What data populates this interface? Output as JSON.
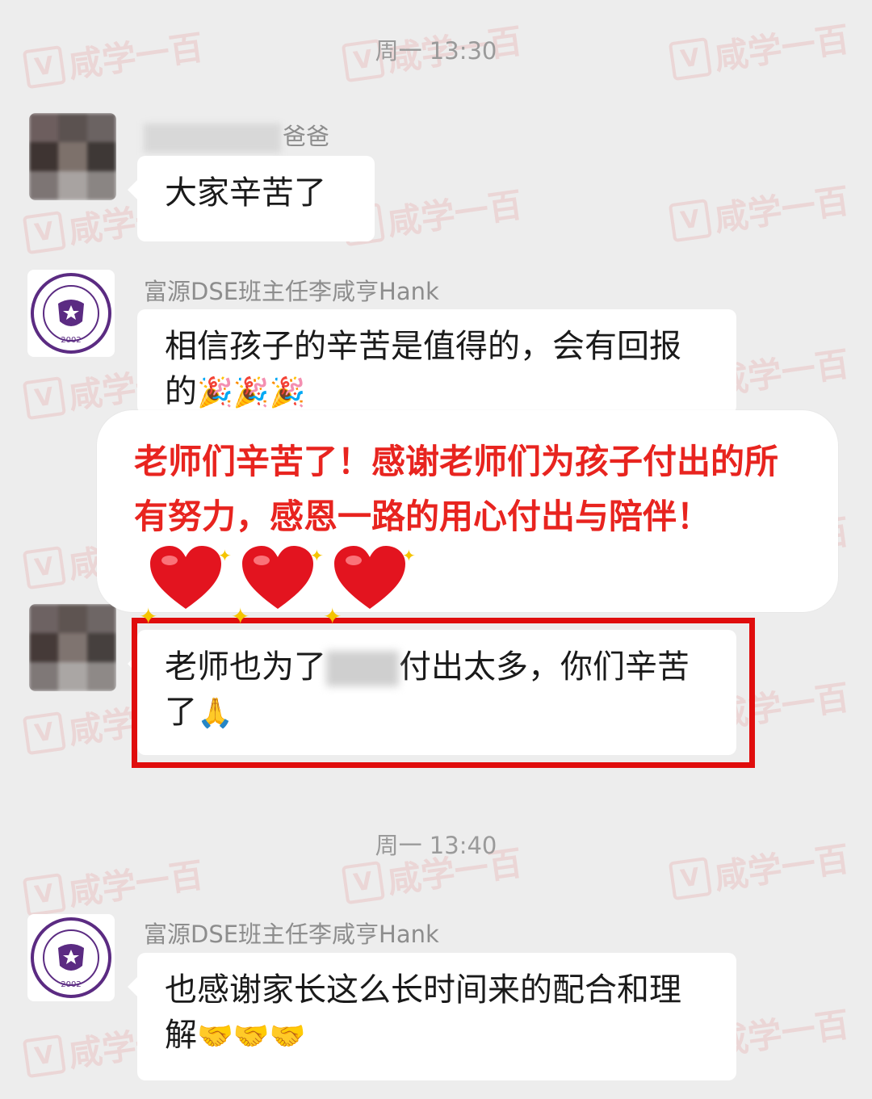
{
  "timestamps": [
    "周一 13:30",
    "周一 13:40"
  ],
  "watermark": "咸学一百",
  "messages": [
    {
      "sender_suffix": "爸爸",
      "text": "大家辛苦了"
    },
    {
      "sender": "富源DSE班主任李咸亨Hank",
      "text": "相信孩子的辛苦是值得的，会有回报的",
      "emoji": "🎉🎉🎉"
    },
    {
      "text_before": "老师也为了",
      "text_after": "付出太多，你们辛苦了",
      "emoji": "🙏"
    },
    {
      "sender": "富源DSE班主任李咸亨Hank",
      "text": "也感谢家长这么长时间来的配合和理解",
      "emoji": "🤝🤝🤝"
    }
  ],
  "overlay": {
    "text": "老师们辛苦了！感谢老师们为孩子付出的所有努力，感恩一路的用心付出与陪伴！",
    "color": "#e8241f"
  },
  "school_logo": {
    "top_text": "FUYUAN BRITISH AMERICAN SCHOOL",
    "year": "2002",
    "color": "#5b2b82"
  }
}
